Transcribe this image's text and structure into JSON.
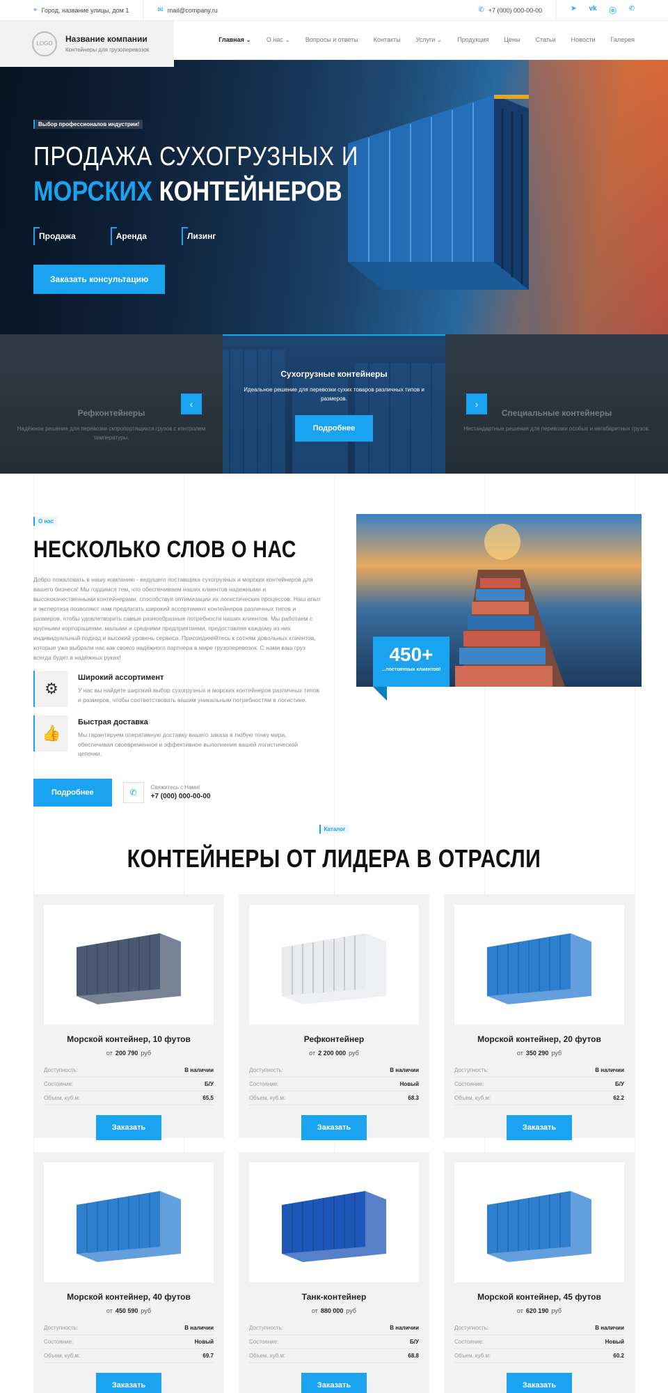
{
  "topbar": {
    "address": "Город, название улицы, дом 1",
    "email": "mail@company.ru",
    "phone": "+7 (000) 000-00-00",
    "socials": [
      "telegram",
      "vk",
      "ok",
      "whatsapp"
    ]
  },
  "header": {
    "logo_text": "LOGO",
    "company_name": "Название компании",
    "tagline": "Контейнеры для грузоперевозок",
    "nav": [
      {
        "label": "Главная",
        "dropdown": true,
        "active": true
      },
      {
        "label": "О нас",
        "dropdown": true
      },
      {
        "label": "Вопросы и ответы"
      },
      {
        "label": "Контакты"
      },
      {
        "label": "Услуги",
        "dropdown": true
      },
      {
        "label": "Продукция"
      },
      {
        "label": "Цены"
      },
      {
        "label": "Статьи"
      },
      {
        "label": "Новости"
      },
      {
        "label": "Галерея"
      }
    ]
  },
  "hero": {
    "badge": "Выбор профессионалов индустрии!",
    "title_line1": "ПРОДАЖА СУХОГРУЗНЫХ И",
    "title_blue": "МОРСКИХ",
    "title_white": "КОНТЕЙНЕРОВ",
    "tags": [
      "Продажа",
      "Аренда",
      "Лизинг"
    ],
    "cta": "Заказать консультацию"
  },
  "slider": {
    "left": {
      "title": "Рефконтейнеры",
      "desc": "Надёжное решение для перевозки скоропортящихся грузов с контролем температуры."
    },
    "center": {
      "title": "Сухогрузные контейнеры",
      "desc": "Идеальное решение для перевозки сухих товаров различных типов и размеров.",
      "button": "Подробнее"
    },
    "right": {
      "title": "Специальные контейнеры",
      "desc": "Нестандартные решения для перевозки особых и негабаритных грузов."
    },
    "prev": "‹",
    "next": "›"
  },
  "about": {
    "badge": "О нас",
    "title": "НЕСКОЛЬКО СЛОВ О НАС",
    "text": "Добро пожаловать в нашу компанию - ведущего поставщика сухогрузных и морских контейнеров для вашего бизнеса! Мы гордимся тем, что обеспечиваем наших клиентов надежными и высококачественными контейнерами, способствуя оптимизации их логистических процессов. Наш опыт и экспертиза позволяют нам предлагать широкий ассортимент контейнеров различных типов и размеров, чтобы удовлетворить самые разнообразные потребности наших клиентов. Мы работаем с крупными корпорациями, малыми и средними предприятиями, предоставляя каждому из них индивидуальный подход и высокий уровень сервиса. Присоединяйтесь к сотням довольных клиентов, которые уже выбрали нас как своего надёжного партнера в мире грузоперевозок. С нами ваш груз всегда будет в надёжных руках!",
    "features": [
      {
        "icon": "crane-icon",
        "title": "Широкий ассортимент",
        "desc": "У нас вы найдете широкий выбор сухогрузных и морских контейнеров различных типов и размеров, чтобы соответствовать вашим уникальным потребностям в логистике."
      },
      {
        "icon": "thumbs-up-icon",
        "title": "Быстрая доставка",
        "desc": "Мы гарантируем оперативную доставку вашего заказа в любую точку мира, обеспечивая своевременное и эффективное выполнение вашей логистической цепочки."
      }
    ],
    "button": "Подробнее",
    "contact_label": "Свяжитесь с Нами!",
    "contact_phone": "+7 (000) 000-00-00",
    "stat_number": "450+",
    "stat_label": "...постоянных клиентов!"
  },
  "catalog": {
    "badge": "Каталог",
    "title": "КОНТЕЙНЕРЫ ОТ ЛИДЕРА В ОТРАСЛИ",
    "labels": {
      "from": "от",
      "currency": "руб",
      "availability": "Доступность:",
      "condition": "Состояние:",
      "volume": "Объем, куб.м:",
      "order": "Заказать"
    },
    "items": [
      {
        "name": "Морской контейнер, 10 футов",
        "price": "200 790",
        "availability": "В наличии",
        "condition": "Б/У",
        "volume": "65.5",
        "color": "#4a5a72"
      },
      {
        "name": "Рефконтейнер",
        "price": "2 200 000",
        "availability": "В наличии",
        "condition": "Новый",
        "volume": "68.3",
        "color": "#e8eaee"
      },
      {
        "name": "Морской контейнер, 20 футов",
        "price": "350 290",
        "availability": "В наличии",
        "condition": "Б/У",
        "volume": "62.2",
        "color": "#2f7fd0"
      },
      {
        "name": "Морской контейнер, 40 футов",
        "price": "450 590",
        "availability": "В наличии",
        "condition": "Новый",
        "volume": "69.7",
        "color": "#2f7fd0"
      },
      {
        "name": "Танк-контейнер",
        "price": "880 000",
        "availability": "В наличии",
        "condition": "Б/У",
        "volume": "68.8",
        "color": "#1e57b8"
      },
      {
        "name": "Морской контейнер, 45 футов",
        "price": "620 190",
        "availability": "В наличии",
        "condition": "Новый",
        "volume": "60.2",
        "color": "#2f7fd0"
      }
    ]
  }
}
